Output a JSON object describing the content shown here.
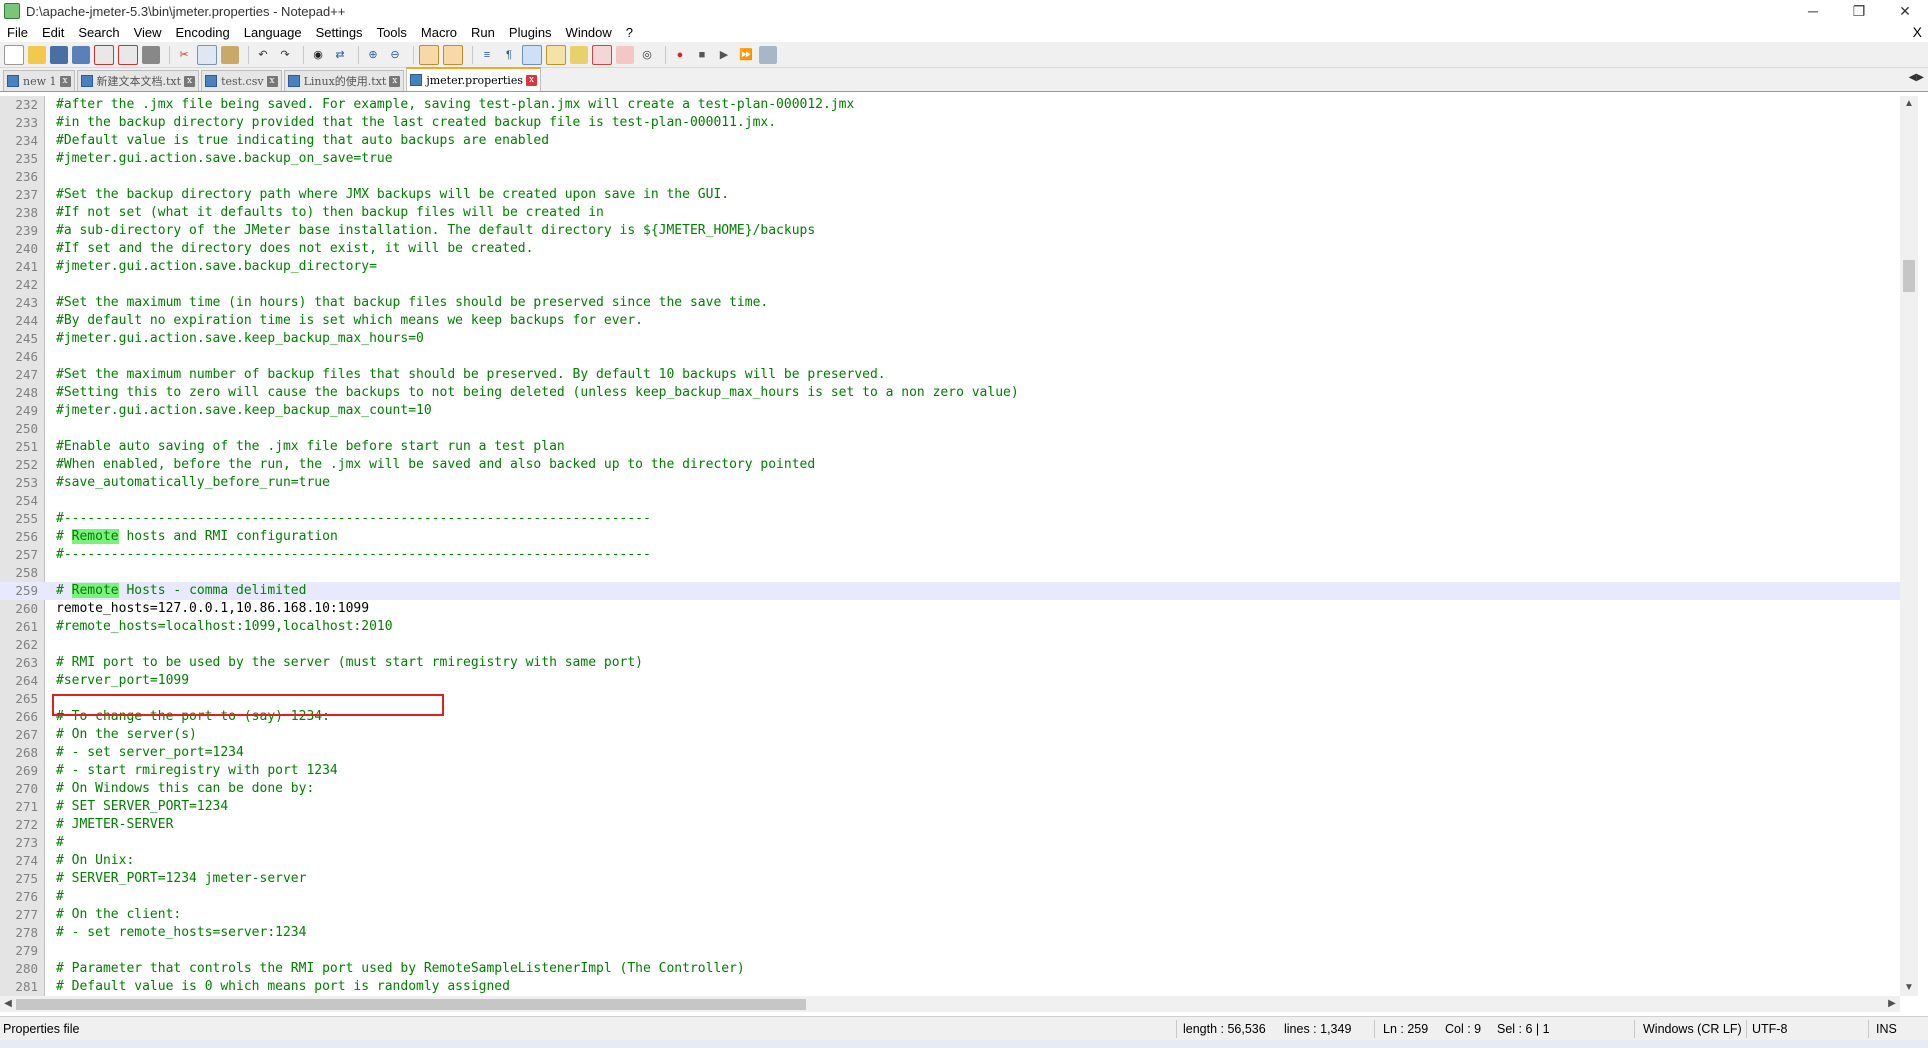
{
  "window": {
    "title": "D:\\apache-jmeter-5.3\\bin\\jmeter.properties - Notepad++",
    "minimize": "─",
    "restore": "❐",
    "close": "✕"
  },
  "menu": {
    "items": [
      "File",
      "Edit",
      "Search",
      "View",
      "Encoding",
      "Language",
      "Settings",
      "Tools",
      "Macro",
      "Run",
      "Plugins",
      "Window",
      "?"
    ],
    "close": "X"
  },
  "tabs": [
    {
      "label": "new 1",
      "active": false
    },
    {
      "label": "新建文本文档.txt",
      "active": false
    },
    {
      "label": "test.csv",
      "active": false
    },
    {
      "label": "Linux的使用.txt",
      "active": false
    },
    {
      "label": "jmeter.properties",
      "active": true
    }
  ],
  "editor": {
    "current_line": 259,
    "highlight_word": "Remote",
    "lines": [
      {
        "n": "232",
        "t": "#after the .jmx file being saved. For example, saving test-plan.jmx will create a test-plan-000012.jmx"
      },
      {
        "n": "233",
        "t": "#in the backup directory provided that the last created backup file is test-plan-000011.jmx."
      },
      {
        "n": "234",
        "t": "#Default value is true indicating that auto backups are enabled"
      },
      {
        "n": "235",
        "t": "#jmeter.gui.action.save.backup_on_save=true"
      },
      {
        "n": "236",
        "t": ""
      },
      {
        "n": "237",
        "t": "#Set the backup directory path where JMX backups will be created upon save in the GUI."
      },
      {
        "n": "238",
        "t": "#If not set (what it defaults to) then backup files will be created in"
      },
      {
        "n": "239",
        "t": "#a sub-directory of the JMeter base installation. The default directory is ${JMETER_HOME}/backups"
      },
      {
        "n": "240",
        "t": "#If set and the directory does not exist, it will be created."
      },
      {
        "n": "241",
        "t": "#jmeter.gui.action.save.backup_directory="
      },
      {
        "n": "242",
        "t": ""
      },
      {
        "n": "243",
        "t": "#Set the maximum time (in hours) that backup files should be preserved since the save time."
      },
      {
        "n": "244",
        "t": "#By default no expiration time is set which means we keep backups for ever."
      },
      {
        "n": "245",
        "t": "#jmeter.gui.action.save.keep_backup_max_hours=0"
      },
      {
        "n": "246",
        "t": ""
      },
      {
        "n": "247",
        "t": "#Set the maximum number of backup files that should be preserved. By default 10 backups will be preserved."
      },
      {
        "n": "248",
        "t": "#Setting this to zero will cause the backups to not being deleted (unless keep_backup_max_hours is set to a non zero value)"
      },
      {
        "n": "249",
        "t": "#jmeter.gui.action.save.keep_backup_max_count=10"
      },
      {
        "n": "250",
        "t": ""
      },
      {
        "n": "251",
        "t": "#Enable auto saving of the .jmx file before start run a test plan"
      },
      {
        "n": "252",
        "t": "#When enabled, before the run, the .jmx will be saved and also backed up to the directory pointed"
      },
      {
        "n": "253",
        "t": "#save_automatically_before_run=true"
      },
      {
        "n": "254",
        "t": ""
      },
      {
        "n": "255",
        "t": "#---------------------------------------------------------------------------"
      },
      {
        "n": "256",
        "t": "# Remote hosts and RMI configuration"
      },
      {
        "n": "257",
        "t": "#---------------------------------------------------------------------------"
      },
      {
        "n": "258",
        "t": ""
      },
      {
        "n": "259",
        "t": "# Remote Hosts - comma delimited"
      },
      {
        "n": "260",
        "t": "remote_hosts=127.0.0.1,10.86.168.10:1099"
      },
      {
        "n": "261",
        "t": "#remote_hosts=localhost:1099,localhost:2010"
      },
      {
        "n": "262",
        "t": ""
      },
      {
        "n": "263",
        "t": "# RMI port to be used by the server (must start rmiregistry with same port)"
      },
      {
        "n": "264",
        "t": "#server_port=1099"
      },
      {
        "n": "265",
        "t": ""
      },
      {
        "n": "266",
        "t": "# To change the port to (say) 1234:"
      },
      {
        "n": "267",
        "t": "# On the server(s)"
      },
      {
        "n": "268",
        "t": "# - set server_port=1234"
      },
      {
        "n": "269",
        "t": "# - start rmiregistry with port 1234"
      },
      {
        "n": "270",
        "t": "# On Windows this can be done by:"
      },
      {
        "n": "271",
        "t": "# SET SERVER_PORT=1234"
      },
      {
        "n": "272",
        "t": "# JMETER-SERVER"
      },
      {
        "n": "273",
        "t": "#"
      },
      {
        "n": "274",
        "t": "# On Unix:"
      },
      {
        "n": "275",
        "t": "# SERVER_PORT=1234 jmeter-server"
      },
      {
        "n": "276",
        "t": "#"
      },
      {
        "n": "277",
        "t": "# On the client:"
      },
      {
        "n": "278",
        "t": "# - set remote_hosts=server:1234"
      },
      {
        "n": "279",
        "t": ""
      },
      {
        "n": "280",
        "t": "# Parameter that controls the RMI port used by RemoteSampleListenerImpl (The Controller)"
      },
      {
        "n": "281",
        "t": "# Default value is 0 which means port is randomly assigned"
      }
    ]
  },
  "status": {
    "file_type": "Properties file",
    "length": "length : 56,536",
    "lines": "lines : 1,349",
    "ln": "Ln : 259",
    "col": "Col : 9",
    "sel": "Sel : 6 | 1",
    "eol": "Windows (CR LF)",
    "encoding": "UTF-8",
    "mode": "INS"
  },
  "colors": {
    "comment": "#008000",
    "highlight": "#7cf07c",
    "current_line": "#e8e8ff",
    "annotation_box": "#e02020"
  }
}
